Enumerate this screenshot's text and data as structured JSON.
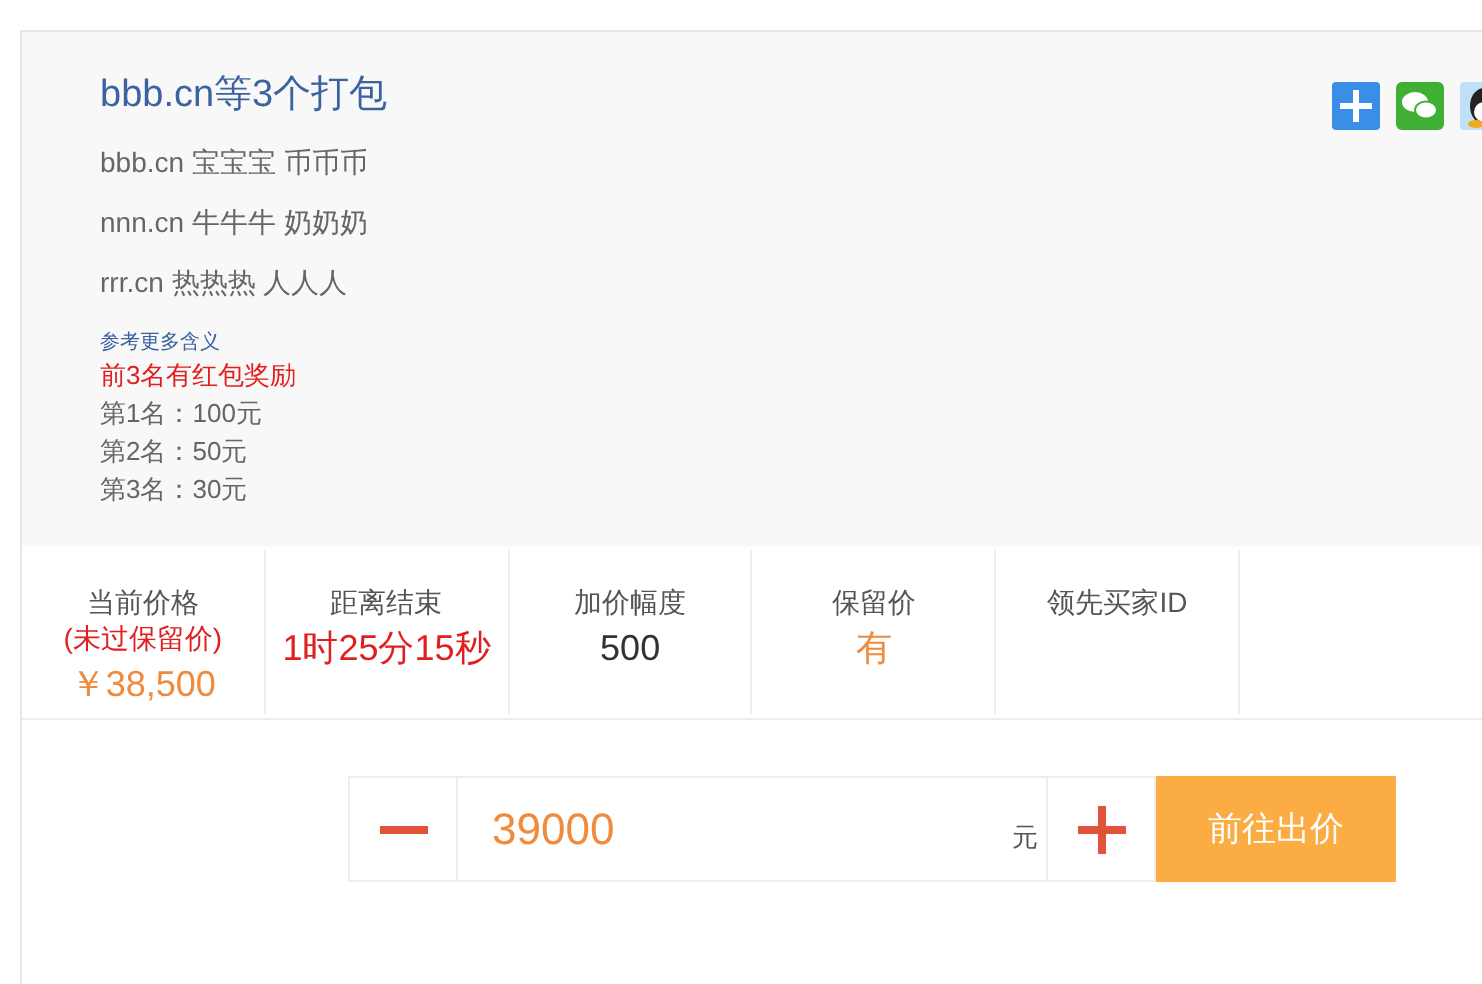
{
  "header": {
    "title": "bbb.cn等3个打包",
    "lines": [
      "bbb.cn 宝宝宝 币币币",
      "nnn.cn 牛牛牛 奶奶奶",
      "rrr.cn 热热热 人人人"
    ],
    "more_link": "参考更多含义",
    "reward_title": "前3名有红包奖励",
    "rewards": [
      "第1名：100元",
      "第2名：50元",
      "第3名：30元"
    ]
  },
  "stats": [
    {
      "label": "当前价格",
      "note": "(未过保留价)",
      "value": "￥38,500",
      "color": "#f08a3c"
    },
    {
      "label": "距离结束",
      "value": "1时25分15秒",
      "color": "#e02020"
    },
    {
      "label": "加价幅度",
      "value": "500",
      "color": "#333333"
    },
    {
      "label": "保留价",
      "value": "有",
      "color": "#f08a3c"
    },
    {
      "label": "领先买家ID"
    }
  ],
  "bid": {
    "value": "39000",
    "unit": "元",
    "button": "前往出价"
  }
}
